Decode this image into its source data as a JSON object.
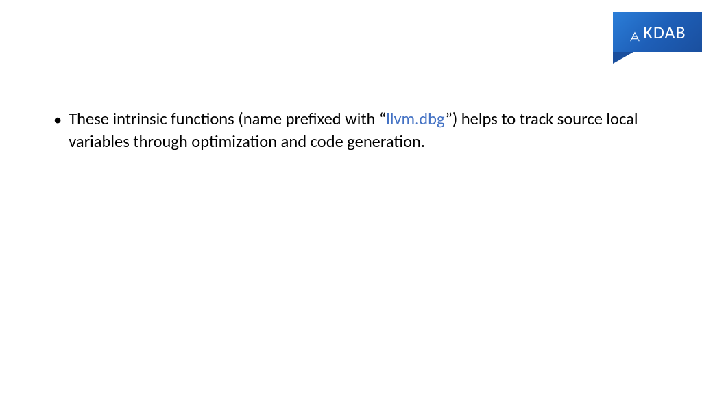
{
  "logo": {
    "text": "KDAB"
  },
  "content": {
    "bullet": {
      "text_before": "These intrinsic functions (name prefixed with “",
      "highlight": "llvm.dbg",
      "text_after": "”) helps to track source local variables through optimization and code generation."
    }
  }
}
